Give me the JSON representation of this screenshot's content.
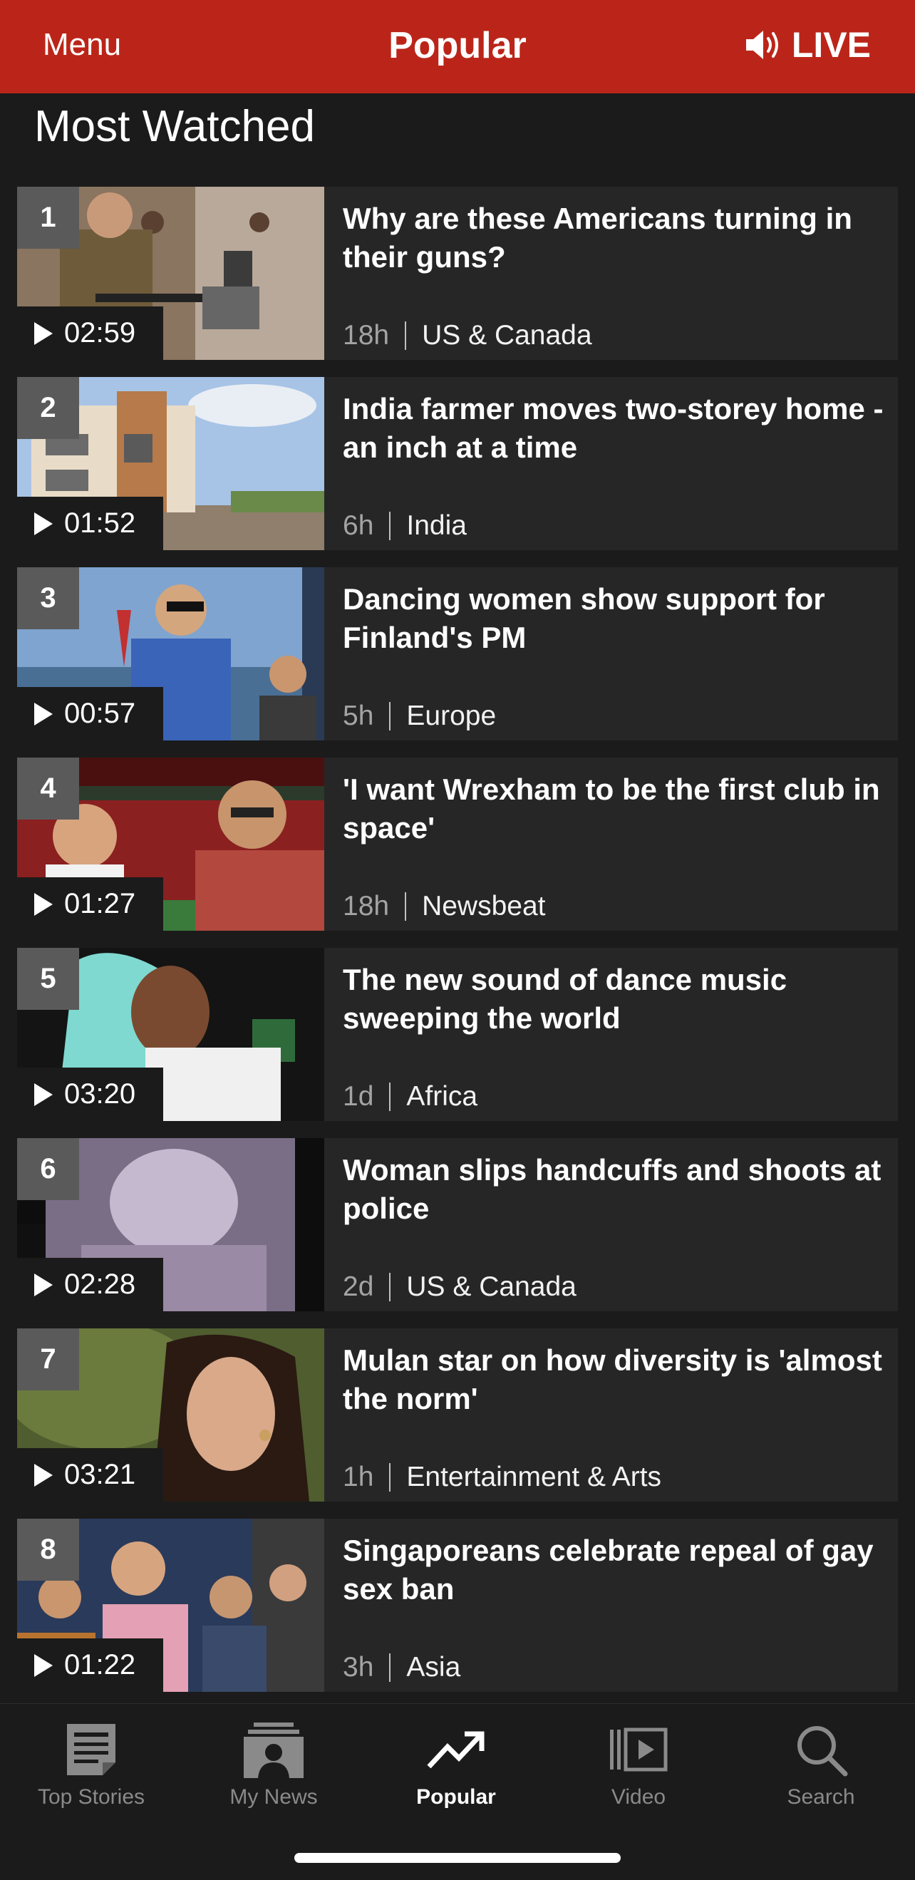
{
  "header": {
    "menu_label": "Menu",
    "title": "Popular",
    "live_label": "LIVE",
    "background_color": "#bb2519"
  },
  "section": {
    "title": "Most Watched"
  },
  "items": [
    {
      "rank": "1",
      "duration": "02:59",
      "headline": "Why are these Americans turning in their guns?",
      "time": "18h",
      "category": "US & Canada"
    },
    {
      "rank": "2",
      "duration": "01:52",
      "headline": "India farmer moves two-storey home - an inch at a time",
      "time": "6h",
      "category": "India"
    },
    {
      "rank": "3",
      "duration": "00:57",
      "headline": "Dancing women show support for Finland's PM",
      "time": "5h",
      "category": "Europe"
    },
    {
      "rank": "4",
      "duration": "01:27",
      "headline": "'I want Wrexham to be the first club in space'",
      "time": "18h",
      "category": "Newsbeat"
    },
    {
      "rank": "5",
      "duration": "03:20",
      "headline": "The new sound of dance music sweeping the world",
      "time": "1d",
      "category": "Africa"
    },
    {
      "rank": "6",
      "duration": "02:28",
      "headline": "Woman slips handcuffs and shoots at police",
      "time": "2d",
      "category": "US & Canada"
    },
    {
      "rank": "7",
      "duration": "03:21",
      "headline": "Mulan star on how diversity is 'almost the norm'",
      "time": "1h",
      "category": "Entertainment & Arts"
    },
    {
      "rank": "8",
      "duration": "01:22",
      "headline": "Singaporeans celebrate repeal of gay sex ban",
      "time": "3h",
      "category": "Asia"
    }
  ],
  "tabbar": {
    "tabs": [
      {
        "label": "Top Stories",
        "icon": "newspaper-icon",
        "active": false
      },
      {
        "label": "My News",
        "icon": "my-news-icon",
        "active": false
      },
      {
        "label": "Popular",
        "icon": "trending-icon",
        "active": true
      },
      {
        "label": "Video",
        "icon": "video-icon",
        "active": false
      },
      {
        "label": "Search",
        "icon": "search-icon",
        "active": false
      }
    ]
  }
}
